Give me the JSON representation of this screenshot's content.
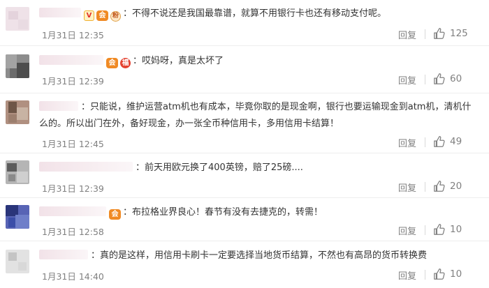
{
  "comments": [
    {
      "badges": [
        "v",
        "vip",
        "fan"
      ],
      "badge_labels": {
        "v": "V",
        "vip": "会",
        "fan": "粉"
      },
      "text": "不得不说还是我国最靠谱，就算不用银行卡也还有移动支付呢。",
      "time": "1月31日 12:35",
      "reply": "回复",
      "likes": "125",
      "avatar_colors": [
        "#e9dbe2",
        "#f2e8ec",
        "#e4d3dc",
        "#efe2e8"
      ]
    },
    {
      "badges": [
        "vip",
        "red"
      ],
      "badge_labels": {
        "vip": "会",
        "red": "福"
      },
      "text": "哎妈呀，真是太坏了",
      "time": "1月31日 12:39",
      "reply": "回复",
      "likes": "60",
      "avatar_colors": [
        "#6b6b6b",
        "#a3a3a3",
        "#4d4d4d",
        "#8c8c8c"
      ]
    },
    {
      "badges": [],
      "badge_labels": {},
      "text": "只能说，维护运营atm机也有成本，毕竟你取的是现金啊，银行也要运输现金到atm机，清机什么的。所以出门在外，备好现金，办一张全币种信用卡，多用信用卡结算！",
      "time": "1月31日 12:45",
      "reply": "回复",
      "likes": "49",
      "avatar_colors": [
        "#9c7f6e",
        "#c8b3a3",
        "#6e5647",
        "#b09080"
      ]
    },
    {
      "badges": [],
      "badge_labels": {},
      "text": "前天用欧元换了400英镑，赔了25磅....",
      "time": "1月31日 12:39",
      "reply": "回复",
      "likes": "20",
      "avatar_colors": [
        "#8a8a8a",
        "#cfcfcf",
        "#5c5c5c",
        "#b5b5b5"
      ]
    },
    {
      "badges": [
        "vip"
      ],
      "badge_labels": {
        "vip": "会"
      },
      "text": "布拉格业界良心！春节有没有去捷克的，转需！",
      "time": "1月31日 12:58",
      "reply": "回复",
      "likes": "10",
      "avatar_colors": [
        "#3b4ea8",
        "#6f7fc9",
        "#2a357a",
        "#5864b5"
      ]
    },
    {
      "badges": [],
      "badge_labels": {},
      "text": "真的是这样，用信用卡刷卡一定要选择当地货币结算，不然也有高昂的货币转换费",
      "time": "1月31日 14:40",
      "reply": "回复",
      "likes": "10",
      "avatar_colors": [
        "#d8d8d8",
        "#ebebeb",
        "#c4c4c4",
        "#e2e2e2"
      ]
    }
  ]
}
